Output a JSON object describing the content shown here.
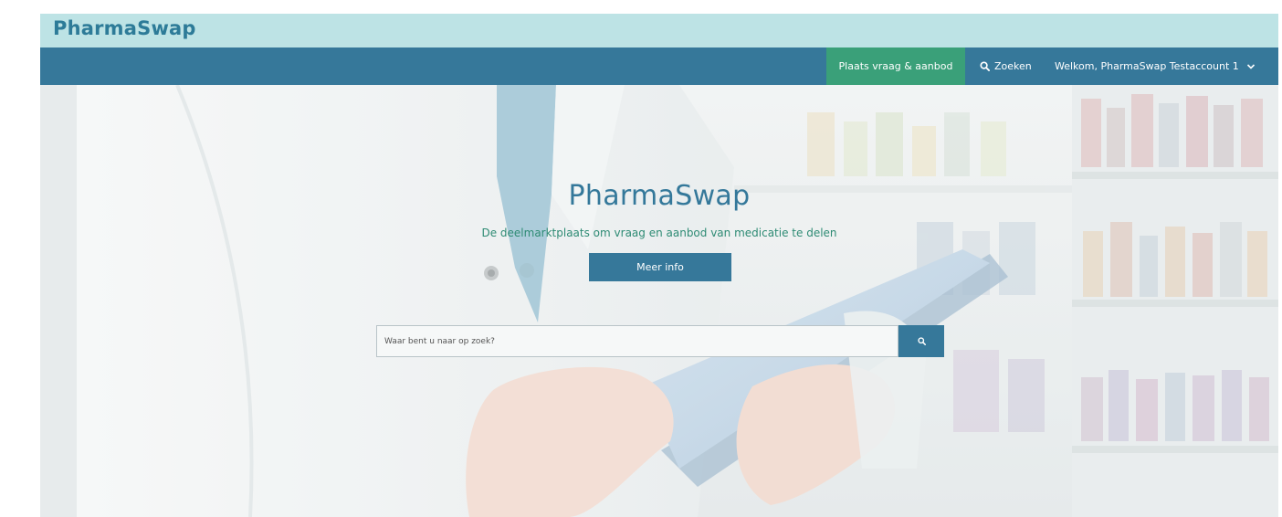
{
  "brand": {
    "logo_text": "PharmaSwap"
  },
  "nav": {
    "place_label": "Plaats vraag & aanbod",
    "search_label": "Zoeken",
    "user_label": "Welkom, PharmaSwap Testaccount 1"
  },
  "hero": {
    "title": "PharmaSwap",
    "subtitle": "De deelmarktplaats om vraag en aanbod van medicatie te delen",
    "button_label": "Meer info"
  },
  "search": {
    "placeholder": "Waar bent u naar op zoek?"
  },
  "icons": {
    "nav_search": "search-icon",
    "user_menu": "chevron-down-icon",
    "hero_search": "search-icon"
  },
  "colors": {
    "brand_bar": "#bde3e5",
    "nav_bar": "#36789a",
    "accent_green": "#3aa079",
    "title_blue": "#34789a",
    "subtitle_green": "#2e8b74"
  }
}
